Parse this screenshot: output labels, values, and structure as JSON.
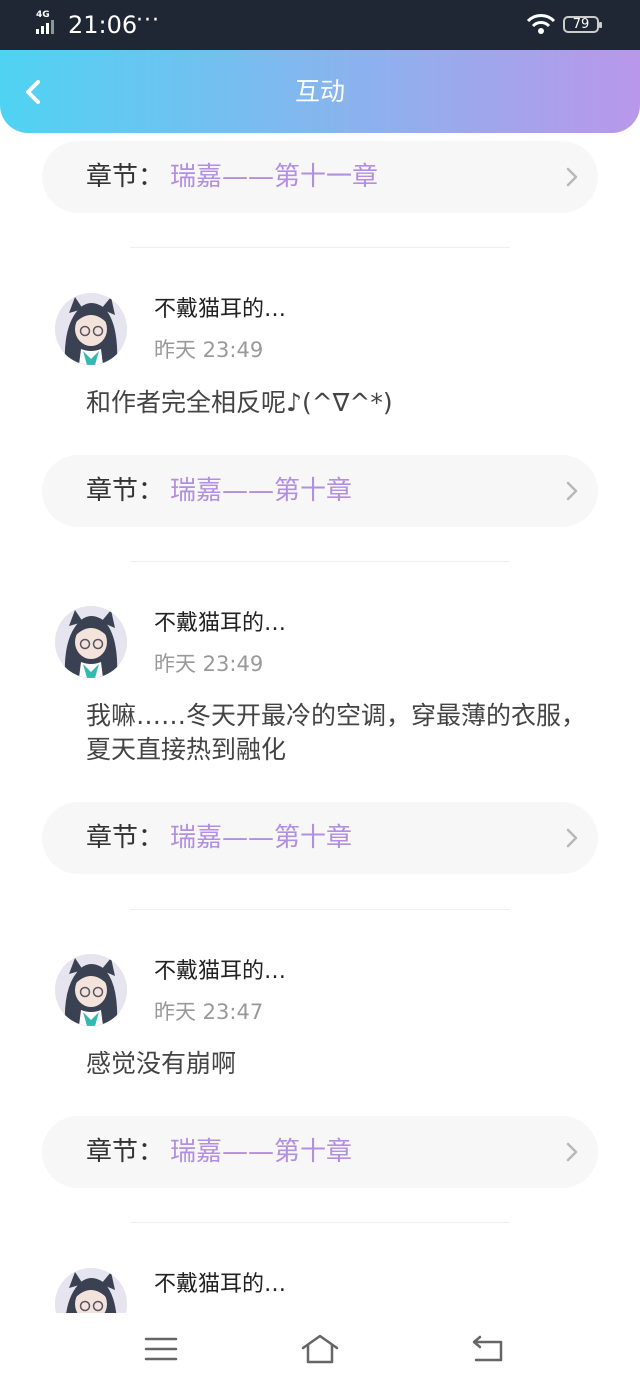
{
  "status_bar": {
    "network": "4G",
    "time": "21:06",
    "dots": "···",
    "battery": "79"
  },
  "header": {
    "title": "互动"
  },
  "chapter_label": "章节：",
  "top_chapter": {
    "name": "瑞嘉——第十一章"
  },
  "comments": [
    {
      "username": "不戴猫耳的…",
      "time": "昨天 23:49",
      "content": "和作者完全相反呢♪(^∇^*)",
      "chapter": "瑞嘉——第十章"
    },
    {
      "username": "不戴猫耳的…",
      "time": "昨天 23:49",
      "content": "我嘛……冬天开最冷的空调，穿最薄的衣服，夏天直接热到融化",
      "chapter": "瑞嘉——第十章"
    },
    {
      "username": "不戴猫耳的…",
      "time": "昨天 23:47",
      "content": "感觉没有崩啊",
      "chapter": "瑞嘉——第十章"
    },
    {
      "username": "不戴猫耳的…"
    }
  ],
  "icons": {
    "back": "chevron-left-icon",
    "chapter_arrow": "chevron-right-icon",
    "nav_menu": "menu-icon",
    "nav_home": "home-icon",
    "nav_back": "return-icon"
  },
  "colors": {
    "accent_start": "#4fd3f3",
    "accent_end": "#b997ea",
    "chapter_text": "#b28fe0"
  }
}
